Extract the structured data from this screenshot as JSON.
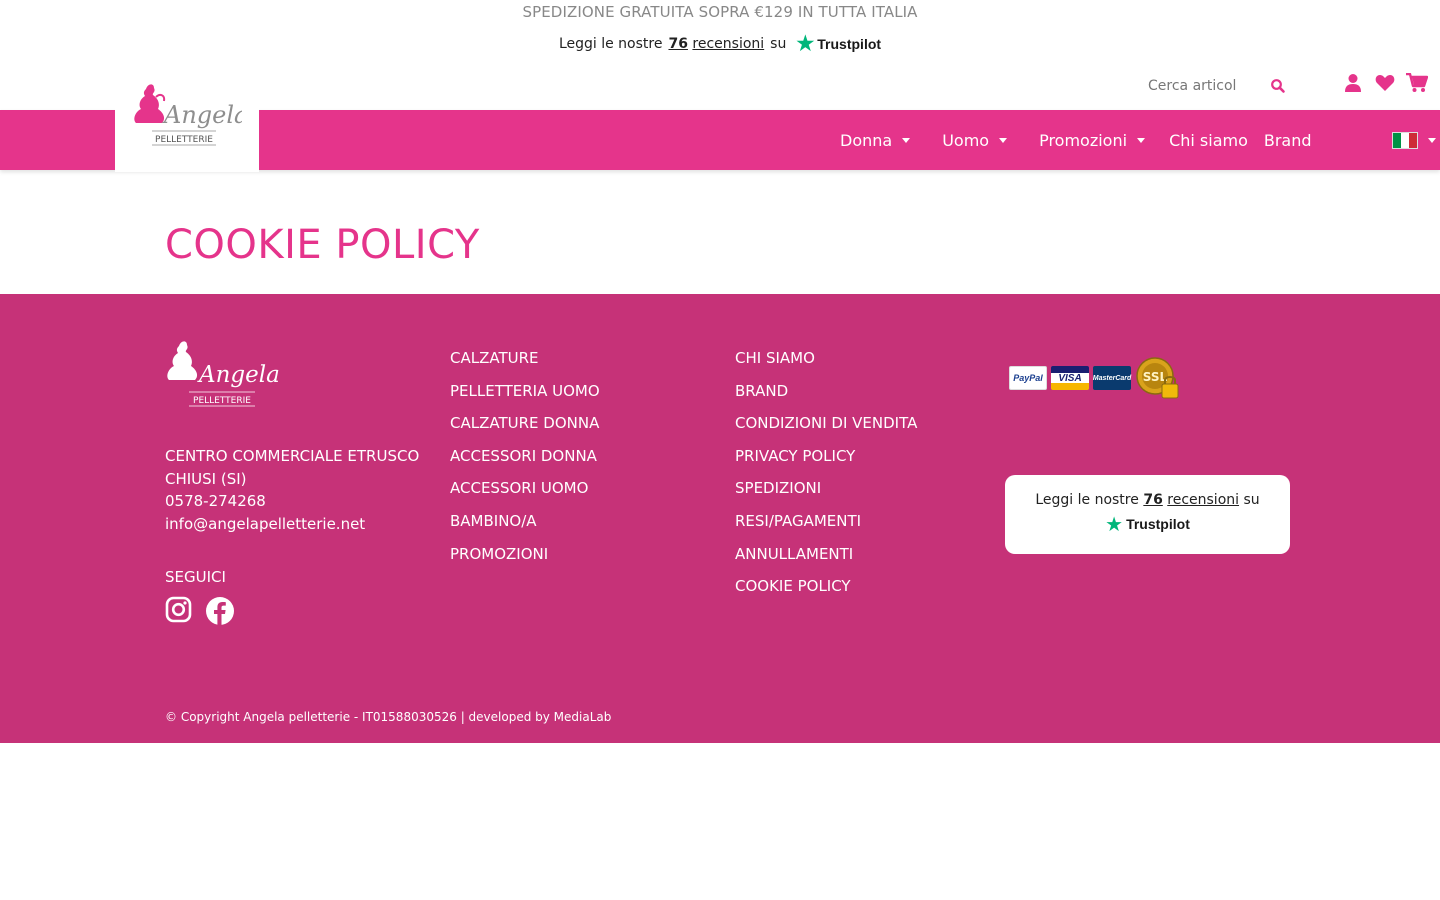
{
  "topbar": {
    "shipping_text": "SPEDIZIONE GRATUITA SOPRA €129 IN TUTTA ITALIA"
  },
  "trustpilot": {
    "prefix": "Leggi le nostre",
    "count": "76",
    "reviews": "recensioni",
    "suffix": "su",
    "brand": "Trustpilot"
  },
  "logo": {
    "name": "Angela",
    "sub": "PELLETTERIE"
  },
  "search": {
    "placeholder": "Cerca articol"
  },
  "nav": {
    "items": [
      {
        "label": "Donna",
        "dropdown": true
      },
      {
        "label": "Uomo",
        "dropdown": true
      },
      {
        "label": "Promozioni",
        "dropdown": true
      },
      {
        "label": "Chi siamo",
        "dropdown": false
      },
      {
        "label": "Brand",
        "dropdown": false
      }
    ],
    "language_flag": "it-flag"
  },
  "page": {
    "title": "COOKIE POLICY"
  },
  "footer": {
    "address": [
      "CENTRO COMMERCIALE ETRUSCO",
      "CHIUSI (SI)",
      "0578-274268",
      "info@angelapelletterie.net"
    ],
    "follow_label": "SEGUICI",
    "social": [
      "instagram-icon",
      "facebook-icon"
    ],
    "col1": [
      "CALZATURE",
      "PELLETTERIA UOMO",
      "CALZATURE DONNA",
      "ACCESSORI DONNA",
      "ACCESSORI UOMO",
      "BAMBINO/A",
      "PROMOZIONI"
    ],
    "col2": [
      "CHI SIAMO",
      "BRAND",
      "CONDIZIONI DI VENDITA",
      "PRIVACY POLICY",
      "SPEDIZIONI",
      "RESI/PAGAMENTI",
      "ANNULLAMENTI",
      "COOKIE POLICY"
    ],
    "payments": [
      "PayPal",
      "VISA",
      "MasterCard",
      "SSL"
    ],
    "copyright": "© Copyright Angela pelletterie - IT01588030526 | developed by MediaLab"
  },
  "colors": {
    "brand_pink": "#e5348b",
    "footer_pink": "#c63278",
    "trustpilot_green": "#00b67a"
  }
}
